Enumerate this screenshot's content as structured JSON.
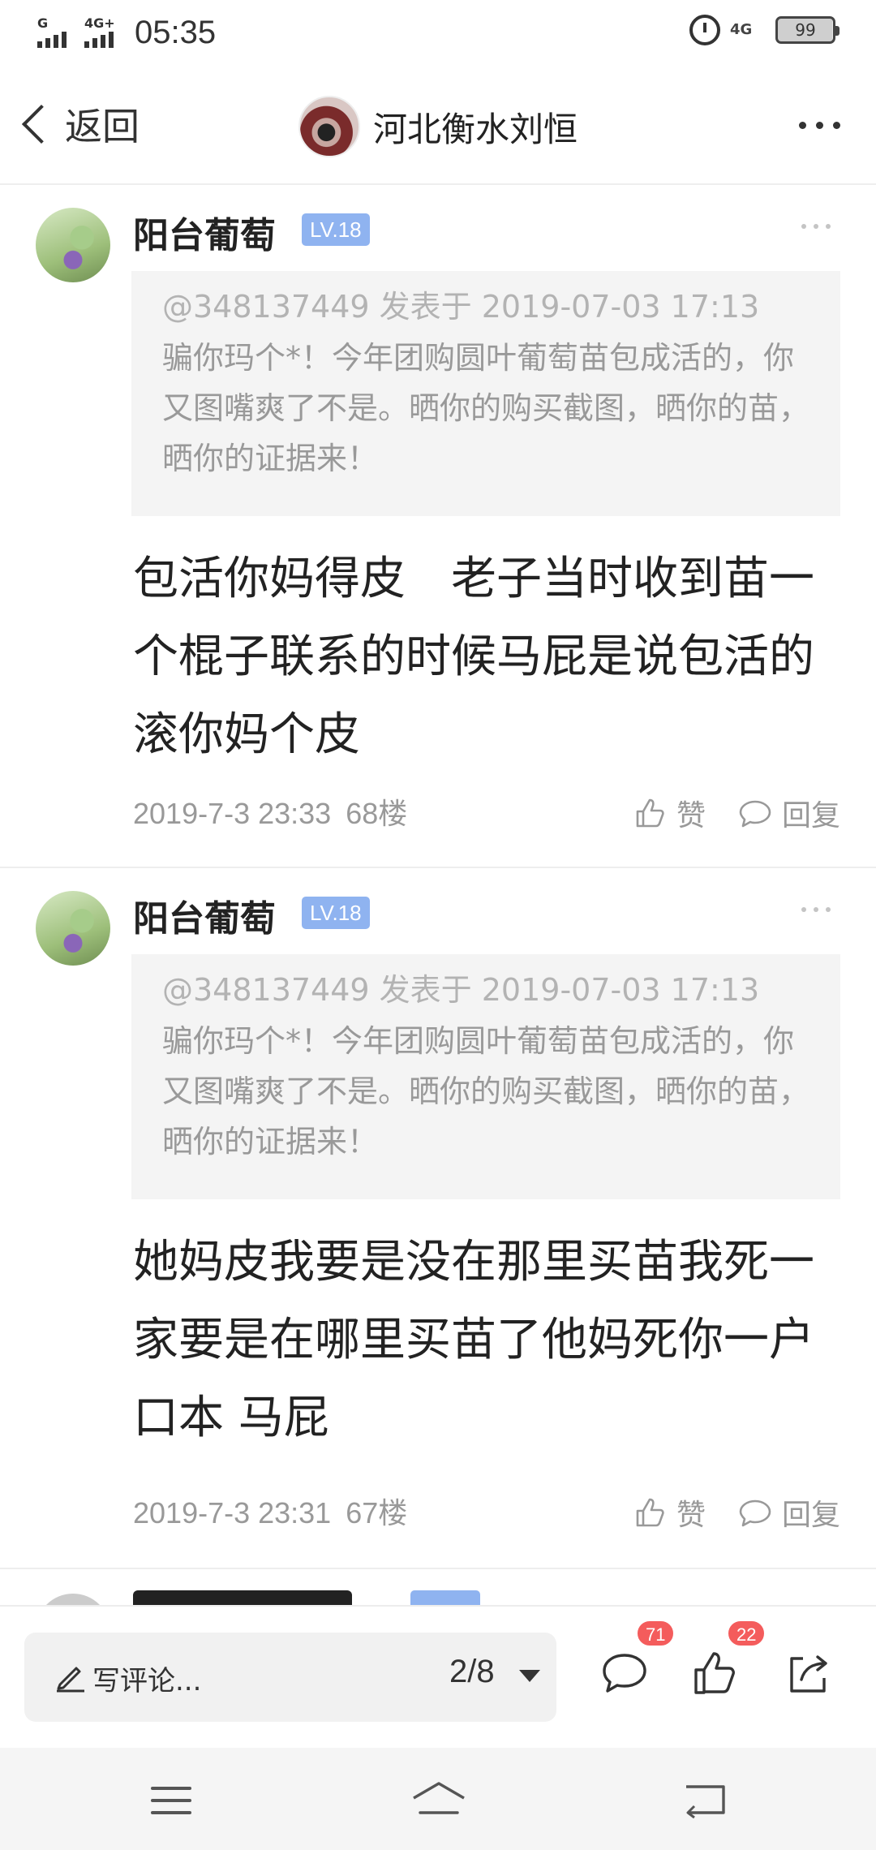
{
  "status_bar": {
    "signal_label": "G",
    "network_label": "4G+",
    "time": "05:35",
    "network_right": "4G",
    "battery": "99"
  },
  "header": {
    "back_label": "返回",
    "title": "河北衡水刘恒"
  },
  "comments": [
    {
      "user": "阳台葡萄",
      "level": "LV.18",
      "quote_meta": "@348137449 发表于 2019-07-03 17:13",
      "quote_text": "骗你玛个*！今年团购圆叶葡萄苗包成活的，你又图嘴爽了不是。晒你的购买截图，晒你的苗，晒你的证据来！",
      "body": "包活你妈得皮　老子当时收到苗一个棍子联系的时候马屁是说包活的滚你妈个皮",
      "time": "2019-7-3 23:33",
      "floor": "68楼",
      "like_label": "赞",
      "reply_label": "回复"
    },
    {
      "user": "阳台葡萄",
      "level": "LV.18",
      "quote_meta": "@348137449 发表于 2019-07-03 17:13",
      "quote_text": "骗你玛个*！今年团购圆叶葡萄苗包成活的，你又图嘴爽了不是。晒你的购买截图，晒你的苗，晒你的证据来！",
      "body": "她妈皮我要是没在那里买苗我死一家要是在哪里买苗了他妈死你一户口本 马屁",
      "time": "2019-7-3 23:31",
      "floor": "67楼",
      "like_label": "赞",
      "reply_label": "回复"
    }
  ],
  "action_bar": {
    "input_placeholder": "写评论...",
    "page_indicator": "2/8",
    "comment_count": "71",
    "like_count": "22"
  },
  "colors": {
    "level_badge": "#8fb3f0",
    "count_badge": "#f45c5c",
    "quote_bg": "#f4f4f4"
  },
  "icons": [
    "back-chevron-icon",
    "more-icon",
    "thumb-up-icon",
    "comment-bubble-icon",
    "pencil-icon",
    "caret-down-icon",
    "share-icon",
    "menu-icon",
    "home-icon",
    "back-icon"
  ]
}
